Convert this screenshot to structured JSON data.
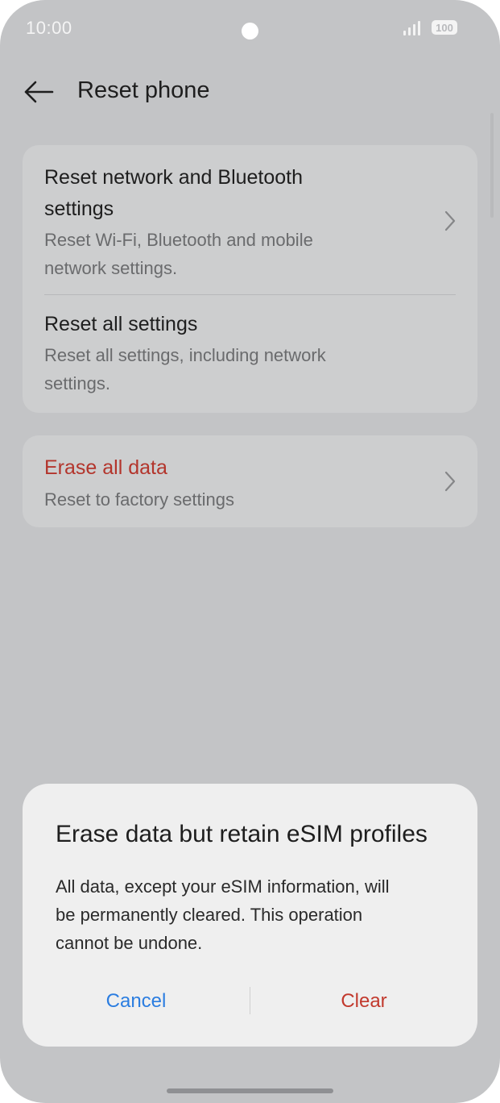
{
  "status_bar": {
    "time": "10:00",
    "battery": "100",
    "icons": [
      "camera-hole",
      "signal-icon",
      "battery-icon"
    ]
  },
  "header": {
    "back_icon": "arrow-left-icon",
    "title": "Reset phone"
  },
  "settings_group": [
    {
      "title": "Reset network and Bluetooth settings",
      "title_line1": "Reset network and Bluetooth",
      "title_line2": "settings",
      "description_line1": "Reset Wi-Fi, Bluetooth and mobile",
      "description_line2": "network settings."
    },
    {
      "title": "Reset all settings",
      "description_line1": "Reset all settings, including network",
      "description_line2": "settings."
    }
  ],
  "erase_item": {
    "title": "Erase all data",
    "description": "Reset to factory settings",
    "title_color": "#b3352c"
  },
  "dialog": {
    "title": "Erase data but retain eSIM profiles",
    "body_line1": "All data, except your eSIM information, will",
    "body_line2": "be permanently cleared. This operation",
    "body_line3": "cannot be undone.",
    "cancel_label": "Cancel",
    "clear_label": "Clear",
    "cancel_color": "#2b7de0",
    "clear_color": "#c2392d"
  },
  "colors": {
    "background": "#c3c4c6",
    "card": "#cdcecf",
    "dialog": "#efefef"
  }
}
